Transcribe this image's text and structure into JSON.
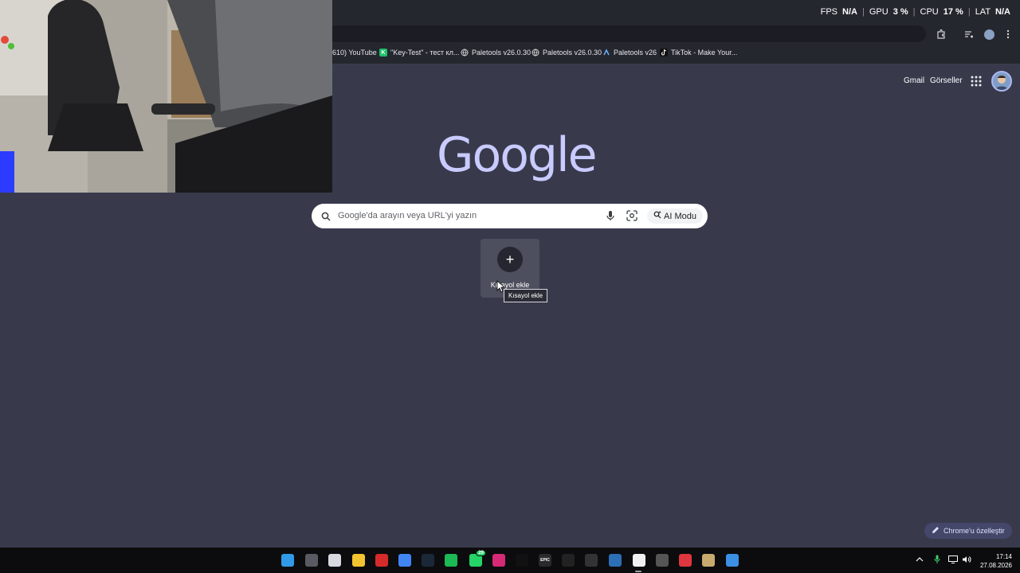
{
  "hud": {
    "fps_label": "FPS",
    "fps_value": "N/A",
    "gpu_label": "GPU",
    "gpu_value": "3 %",
    "cpu_label": "CPU",
    "cpu_value": "17 %",
    "lat_label": "LAT",
    "lat_value": "N/A",
    "separator": "|"
  },
  "bookmarks": [
    {
      "label": "(610) YouTube",
      "icon": "youtube-icon"
    },
    {
      "label": "\"Key-Test\" - тест кл...",
      "icon": "k-icon",
      "fav_text": "K",
      "color": "#1fbf6a"
    },
    {
      "label": "Paletools v26.0.30",
      "icon": "globe-icon"
    },
    {
      "label": "Paletools v26.0.30",
      "icon": "globe-icon"
    },
    {
      "label": "Paletools v26",
      "icon": "paletools-icon"
    },
    {
      "label": "TikTok - Make Your...",
      "icon": "tiktok-icon"
    }
  ],
  "header": {
    "gmail": "Gmail",
    "images": "Görseller"
  },
  "logo": "Google",
  "search": {
    "placeholder": "Google'da arayın veya URL'yi yazın",
    "ai_mode": "AI Modu"
  },
  "shortcut": {
    "label": "Kısayol ekle",
    "tooltip": "Kısayol ekle"
  },
  "customize": {
    "label": "Chrome'u özelleştir"
  },
  "taskbar": {
    "apps": [
      {
        "name": "windows-start-icon",
        "color": "#2f9be8"
      },
      {
        "name": "task-view-icon",
        "color": "#5a5a63"
      },
      {
        "name": "store-icon",
        "color": "#d8d8e0"
      },
      {
        "name": "file-explorer-icon",
        "color": "#f4c430"
      },
      {
        "name": "app-red-icon",
        "color": "#d62b2b"
      },
      {
        "name": "chrome-icon",
        "color": "#4285f4"
      },
      {
        "name": "steam-icon",
        "color": "#1b2838"
      },
      {
        "name": "spotify-icon",
        "color": "#1db954"
      },
      {
        "name": "whatsapp-icon",
        "color": "#25d366",
        "badge": "29"
      },
      {
        "name": "instagram-icon",
        "color": "#d62976"
      },
      {
        "name": "tiktok-icon",
        "color": "#111111"
      },
      {
        "name": "epic-games-icon",
        "color": "#2a2a2a",
        "text": "EPIC"
      },
      {
        "name": "logitech-icon",
        "color": "#222222"
      },
      {
        "name": "app-dark-icon",
        "color": "#333333"
      },
      {
        "name": "app-blue-icon",
        "color": "#2c6fb5"
      },
      {
        "name": "notepad-icon",
        "color": "#f0f0f0"
      },
      {
        "name": "app-circle-icon",
        "color": "#555555"
      },
      {
        "name": "valorant-icon",
        "color": "#e0363f"
      },
      {
        "name": "league-icon",
        "color": "#c8aa6e"
      },
      {
        "name": "defender-icon",
        "color": "#3b8fe4"
      }
    ],
    "time": "17:14",
    "date": "27.08.2026"
  }
}
